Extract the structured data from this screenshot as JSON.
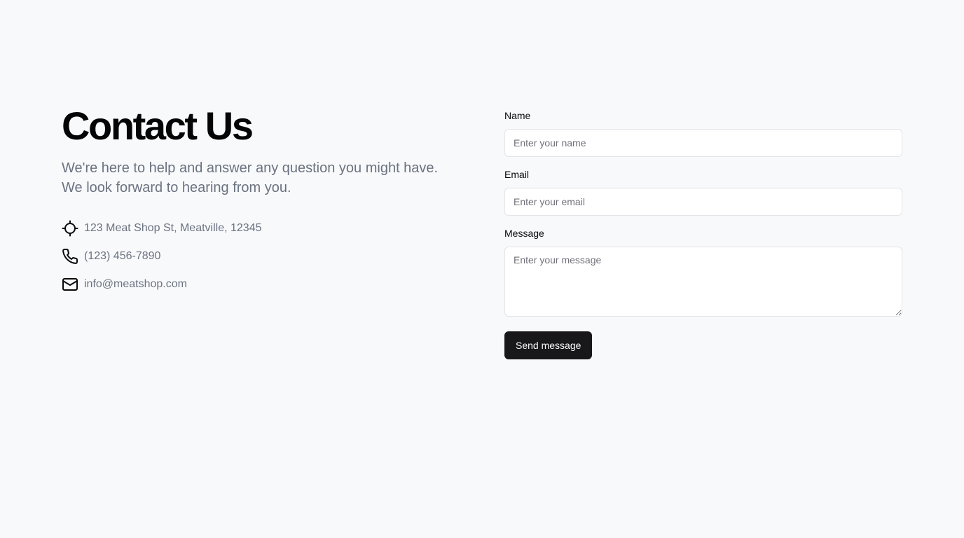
{
  "contact": {
    "title": "Contact Us",
    "subtitle": "We're here to help and answer any question you might have. We look forward to hearing from you.",
    "info": {
      "address": {
        "icon": "crosshair-icon",
        "text": "123 Meat Shop St, Meatville, 12345"
      },
      "phone": {
        "icon": "phone-icon",
        "text": "(123) 456-7890"
      },
      "email": {
        "icon": "mail-icon",
        "text": "info@meatshop.com"
      }
    }
  },
  "form": {
    "name": {
      "label": "Name",
      "placeholder": "Enter your name",
      "value": ""
    },
    "email": {
      "label": "Email",
      "placeholder": "Enter your email",
      "value": ""
    },
    "message": {
      "label": "Message",
      "placeholder": "Enter your message",
      "value": ""
    },
    "submit_label": "Send message"
  },
  "colors": {
    "background": "#f8f9fb",
    "muted_text": "#6b7280",
    "button_bg": "#18181b",
    "button_text": "#fafafa",
    "input_border": "#e4e4e7"
  }
}
